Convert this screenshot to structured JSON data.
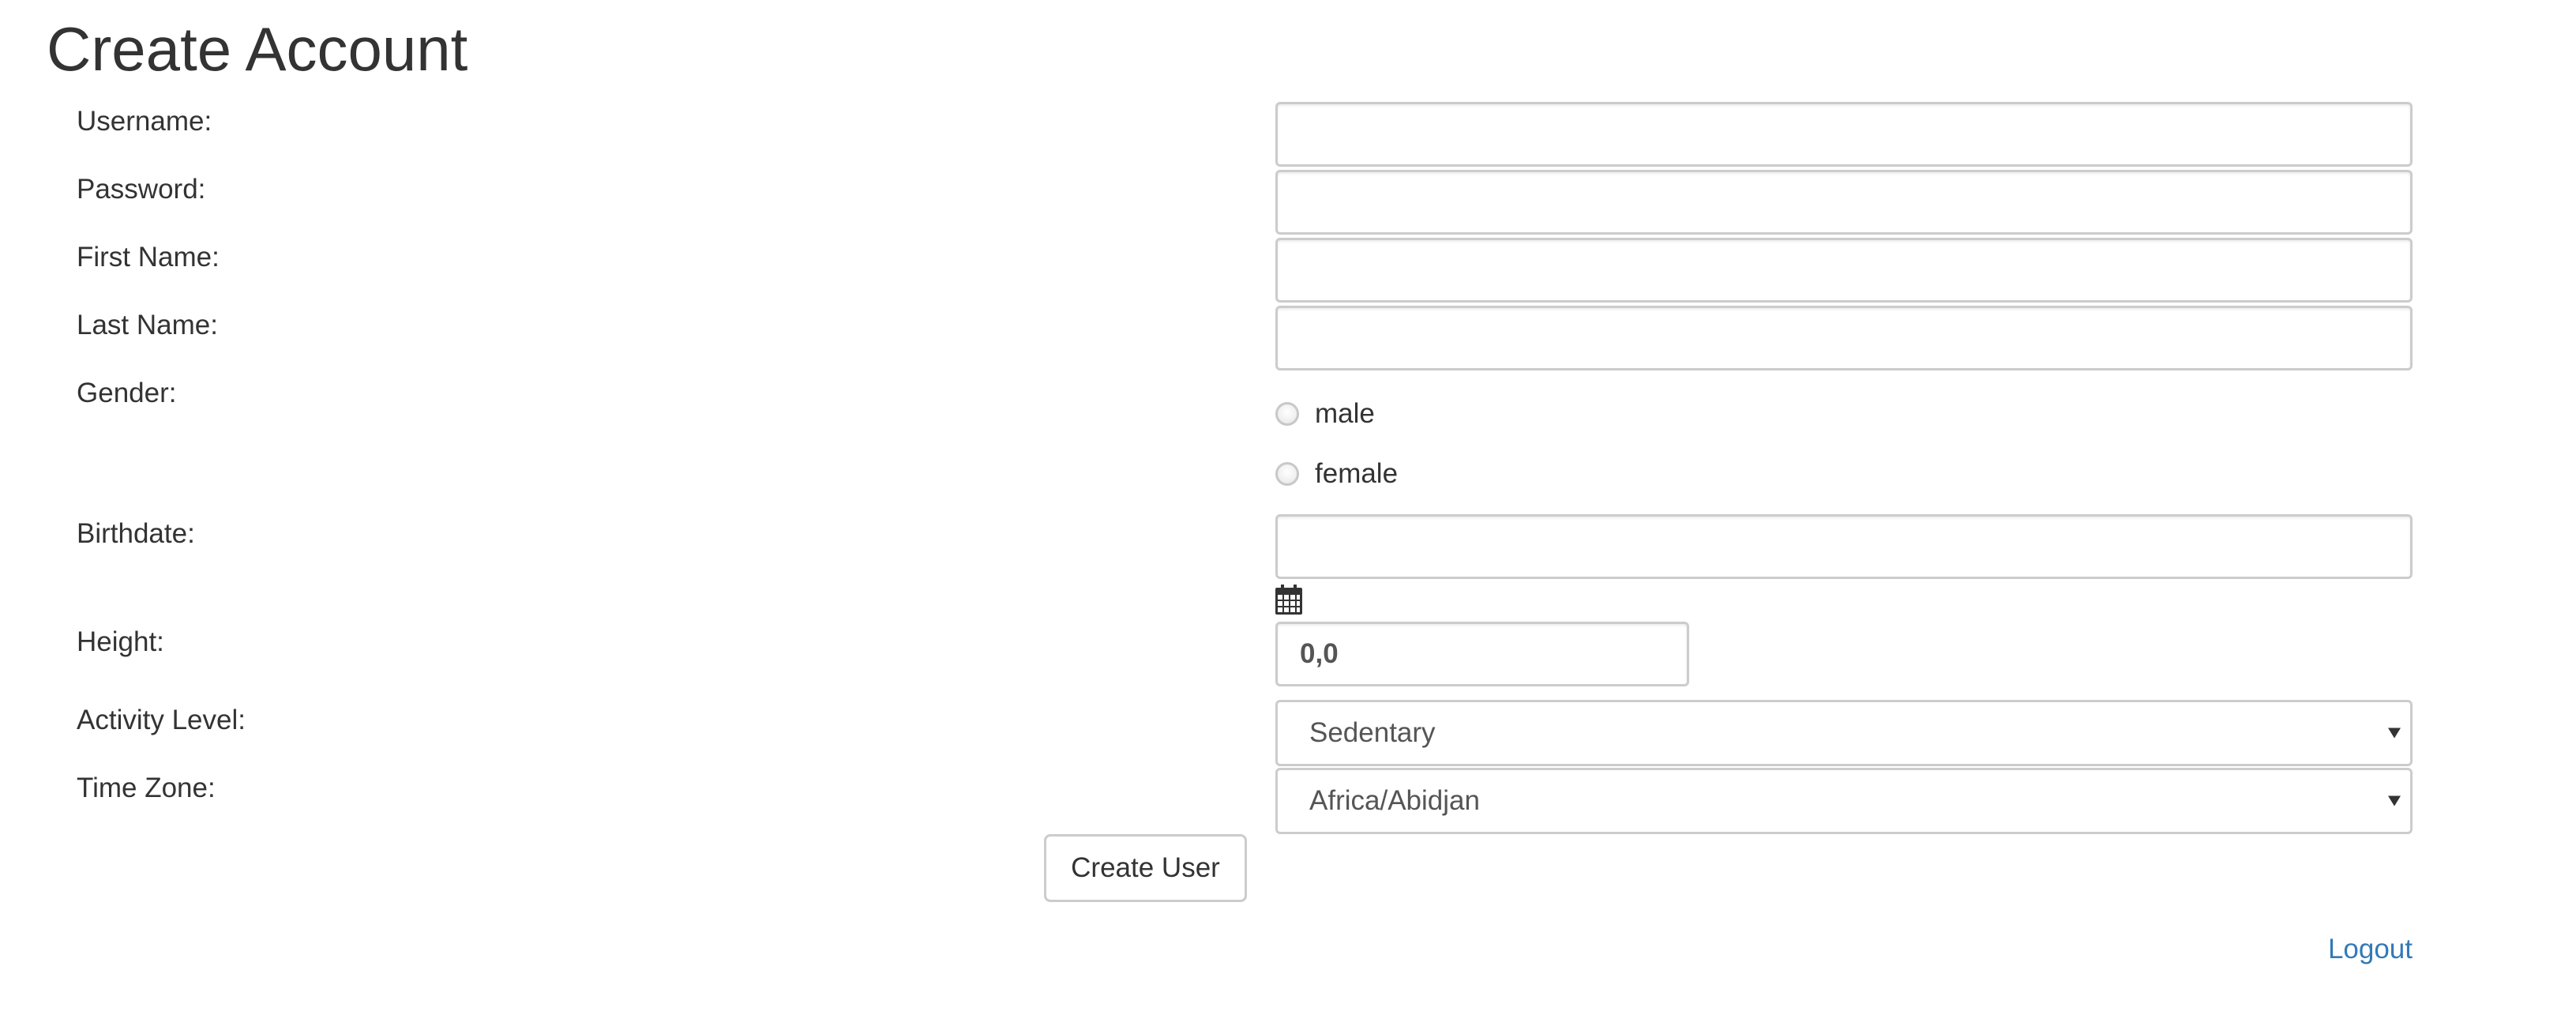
{
  "page": {
    "title": "Create Account"
  },
  "form": {
    "username": {
      "label": "Username:",
      "value": ""
    },
    "password": {
      "label": "Password:",
      "value": ""
    },
    "first_name": {
      "label": "First Name:",
      "value": ""
    },
    "last_name": {
      "label": "Last Name:",
      "value": ""
    },
    "gender": {
      "label": "Gender:",
      "options": [
        "male",
        "female"
      ],
      "selected": null
    },
    "birthdate": {
      "label": "Birthdate:",
      "value": "",
      "icon": "calendar-icon"
    },
    "height": {
      "label": "Height:",
      "value": "0,0"
    },
    "activity_level": {
      "label": "Activity Level:",
      "selected": "Sedentary"
    },
    "time_zone": {
      "label": "Time Zone:",
      "selected": "Africa/Abidjan"
    },
    "submit_label": "Create User"
  },
  "footer": {
    "logout_label": "Logout"
  },
  "colors": {
    "text": "#333333",
    "input_border": "#cccccc",
    "link": "#337ab7"
  }
}
